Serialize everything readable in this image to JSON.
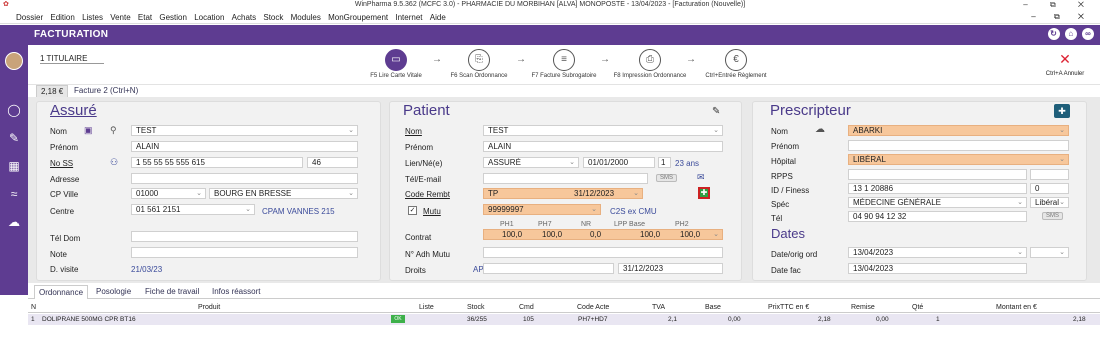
{
  "app": {
    "title": "WinPharma 9.5.362  (MCFC 3.0) - PHARMACIE DU MORBIHAN [ALVA] MONOPOSTE - 13/04/2023 - [Facturation (Nouvelle)]",
    "window_controls": "–  ⧉  ✕",
    "mdi_controls": "–  ⧉  ✕"
  },
  "menu": [
    "Dossier",
    "Edition",
    "Listes",
    "Vente",
    "Etat",
    "Gestion",
    "Location",
    "Achats",
    "Stock",
    "Modules",
    "MonGroupement",
    "Internet",
    "Aide"
  ],
  "header": {
    "title": "FACTURATION"
  },
  "workflow": {
    "titulaire": "1 TITULAIRE",
    "steps": [
      {
        "label": "F5 Lire Carte Vitale",
        "icon": "card-reader-icon"
      },
      {
        "label": "F6 Scan Ordonnance",
        "icon": "scan-icon"
      },
      {
        "label": "F7 Facture Subrogatoire",
        "icon": "invoice-icon"
      },
      {
        "label": "F8 Impression Ordonnance",
        "icon": "print-icon"
      },
      {
        "label": "Ctrl+Entrée Règlement",
        "icon": "payment-icon"
      }
    ],
    "cancel_label": "Ctrl+A Annuler"
  },
  "tabs": {
    "tab1": "2,18 €",
    "tab2": "Facture 2 (Ctrl+N)"
  },
  "assure": {
    "title": "Assuré",
    "nom_label": "Nom",
    "nom": "TEST",
    "prenom_label": "Prénom",
    "prenom": "ALAIN",
    "noss_label": "No SS",
    "noss": "1 55 55 55 555 615",
    "noss_key": "46",
    "adresse_label": "Adresse",
    "adresse": "",
    "cp_label": "CP Ville",
    "cp": "01000",
    "ville": "BOURG EN BRESSE",
    "centre_label": "Centre",
    "centre": "01 561 2151",
    "centre_name": "CPAM VANNES 215",
    "teldom_label": "Tél Dom",
    "teldom": "",
    "note_label": "Note",
    "note": "",
    "dvisite_label": "D. visite",
    "dvisite": "21/03/23"
  },
  "patient": {
    "title": "Patient",
    "nom_label": "Nom",
    "nom": "TEST",
    "prenom_label": "Prénom",
    "prenom": "ALAIN",
    "lien_label": "Lien/Né(e)",
    "lien": "ASSURÉ",
    "ne": "01/01/2000",
    "rang": "1",
    "age": "23 ans",
    "tel_label": "Tél/E-mail",
    "tel": "",
    "rembt_label": "Code Rembt",
    "rembt": "TP",
    "rembt_date": "31/12/2023",
    "mutu_label": "Mutu",
    "mutu": "99999997",
    "mutu_tag": "C2S ex CMU",
    "contrat_label": "Contrat",
    "contrat_headers": [
      "PH1",
      "PH7",
      "NR",
      "LPP Base",
      "PH2"
    ],
    "contrat_values": [
      "100,0",
      "100,0",
      "0,0",
      "100,0",
      "100,0"
    ],
    "nadh_label": "N° Adh Mutu",
    "nadh": "",
    "droits_label": "Droits",
    "droits": "AP",
    "droits_date": "31/12/2023"
  },
  "prescripteur": {
    "title": "Prescripteur",
    "nom_label": "Nom",
    "nom": "ABARKI",
    "prenom_label": "Prénom",
    "prenom": "",
    "hopital_label": "Hôpital",
    "hopital": "LIBÉRAL",
    "rpps_label": "RPPS",
    "rpps": "",
    "finess_label": "ID / Finess",
    "finess": "13 1 20886",
    "finess2": "0",
    "spec_label": "Spéc",
    "spec": "MÉDECINE GÉNÉRALE",
    "spec2": "Libéral",
    "tel_label": "Tél",
    "tel": "04 90 94 12 32",
    "dates_title": "Dates",
    "dateord_label": "Date/orig ord",
    "dateord": "13/04/2023",
    "datefac_label": "Date fac",
    "datefac": "13/04/2023"
  },
  "bottom_tabs": [
    "Ordonnance",
    "Posologie",
    "Fiche de travail",
    "Infos réassort"
  ],
  "grid": {
    "headers": [
      "N",
      "Produit",
      "Liste",
      "Stock",
      "Cmd",
      "Code Acte",
      "TVA",
      "Base",
      "PrixTTC en €",
      "Remise",
      "Qté",
      "Montant en €"
    ],
    "rows": [
      {
        "n": "1",
        "produit": "DOLIPRANE 500MG CPR BT16",
        "liste": "",
        "stock": "36/255",
        "cmd": "105",
        "code": "PH7+HD7",
        "tva": "2,1",
        "base": "0,00",
        "prix": "2,18",
        "remise": "0,00",
        "qte": "1",
        "montant": "2,18"
      }
    ]
  },
  "colors": {
    "accent": "#5e3c91",
    "orange": "#f7c79b"
  }
}
